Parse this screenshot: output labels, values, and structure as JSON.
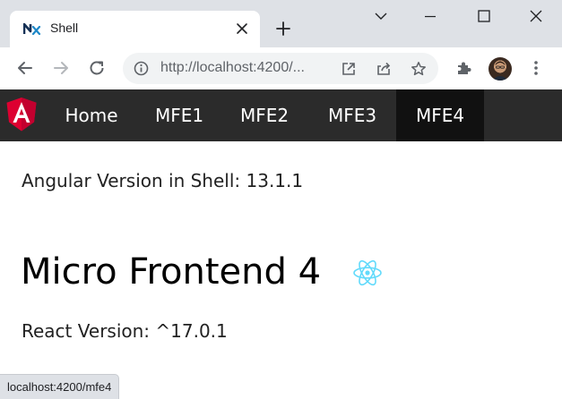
{
  "browser": {
    "tab": {
      "title": "Shell",
      "favicon": "nx-favicon-icon",
      "close_icon": "close-icon"
    },
    "new_tab_icon": "plus-icon",
    "window_controls": [
      "chevron-down-icon",
      "minimize-icon",
      "maximize-icon",
      "close-icon"
    ],
    "toolbar": {
      "back_icon": "back-arrow-icon",
      "forward_icon": "forward-arrow-icon",
      "reload_icon": "reload-icon",
      "info_icon": "info-icon",
      "url": "http://localhost:4200/...",
      "open_in_app_icon": "open-external-icon",
      "share_icon": "share-icon",
      "bookmark_icon": "star-icon",
      "extensions_icon": "puzzle-icon",
      "profile_icon": "avatar",
      "menu_icon": "more-vertical-icon"
    }
  },
  "navbar": {
    "logo": "angular-logo",
    "items": [
      {
        "label": "Home",
        "active": false
      },
      {
        "label": "MFE1",
        "active": false
      },
      {
        "label": "MFE2",
        "active": false
      },
      {
        "label": "MFE3",
        "active": false
      },
      {
        "label": "MFE4",
        "active": true
      }
    ],
    "colors": {
      "background": "#2b2b2b",
      "active_background": "#111111",
      "text": "#ffffff"
    }
  },
  "main": {
    "shell_version": "Angular Version in Shell: 13.1.1",
    "title": "Micro Frontend 4",
    "title_icon": "react-logo",
    "react_version": "React Version: ^17.0.1"
  },
  "status_bar": {
    "link": "localhost:4200/mfe4"
  },
  "colors": {
    "angular_red": "#dd0031",
    "react_cyan": "#61dafb"
  }
}
